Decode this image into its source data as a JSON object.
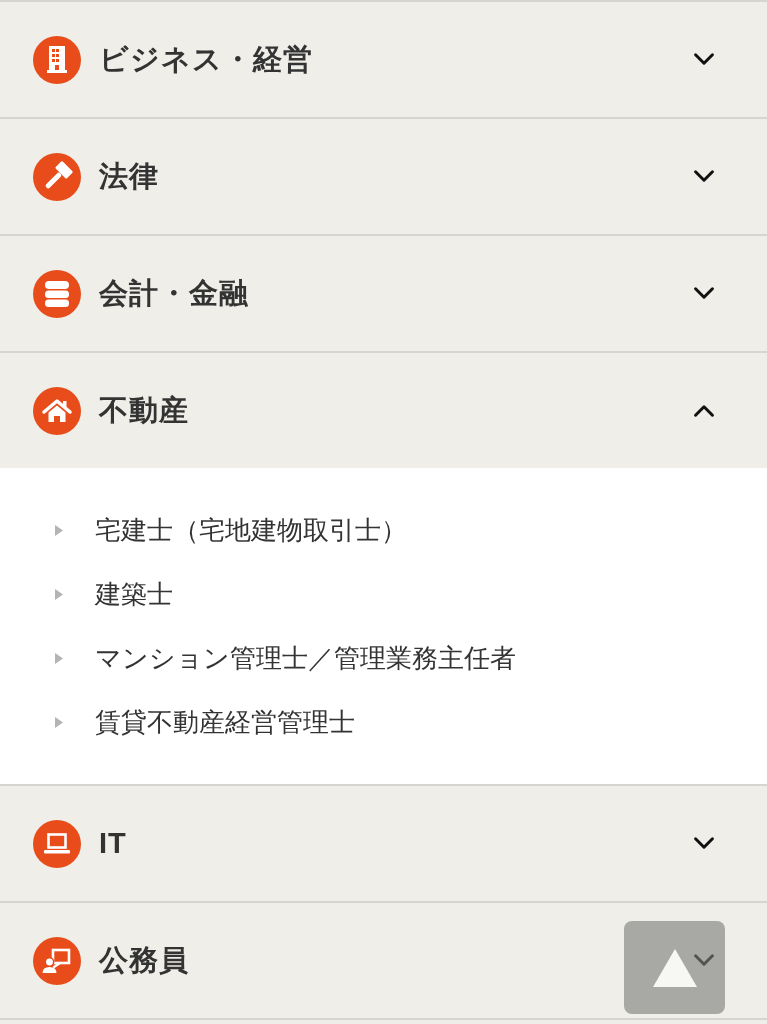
{
  "categories": [
    {
      "label": "ビジネス・経営",
      "expanded": false
    },
    {
      "label": "法律",
      "expanded": false
    },
    {
      "label": "会計・金融",
      "expanded": false
    },
    {
      "label": "不動産",
      "expanded": true,
      "items": [
        "宅建士（宅地建物取引士）",
        "建築士",
        "マンション管理士／管理業務主任者",
        "賃貸不動産経営管理士"
      ]
    },
    {
      "label": "IT",
      "expanded": false
    },
    {
      "label": "公務員",
      "expanded": false
    }
  ]
}
